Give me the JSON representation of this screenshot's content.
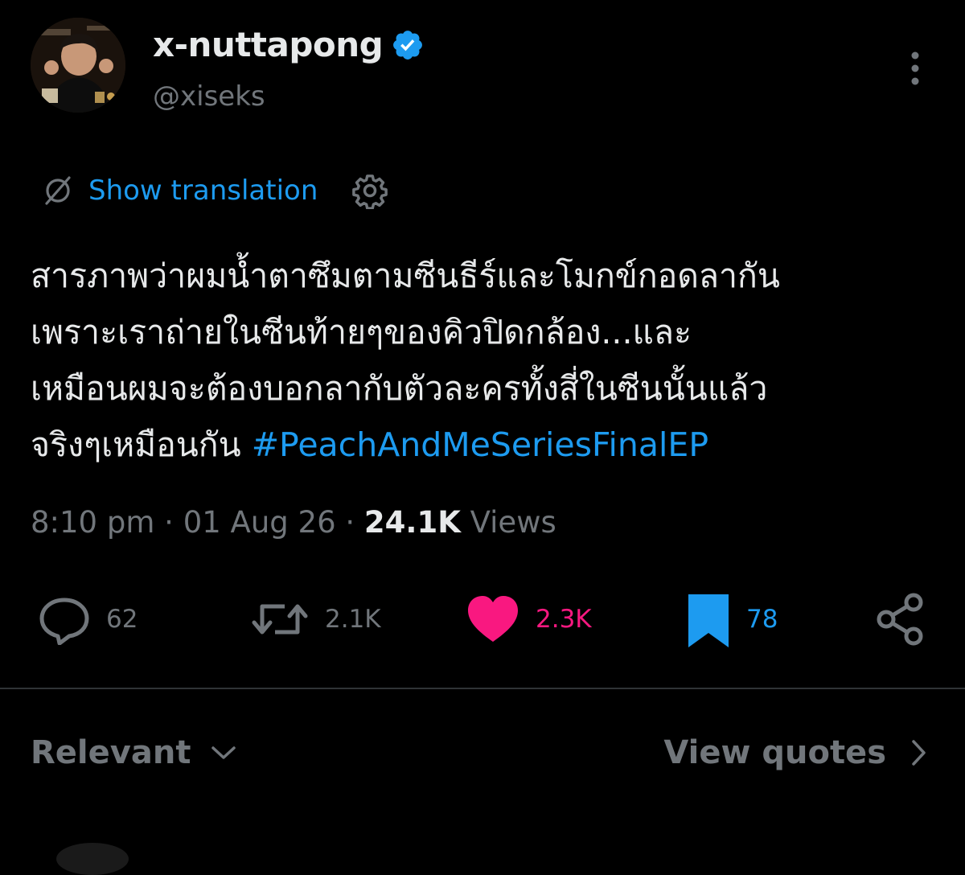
{
  "author": {
    "display_name": "x-nuttapong",
    "handle": "@xiseks",
    "verified_color": "#1d9bf0"
  },
  "translation": {
    "link_label": "Show translation",
    "icon": "translate-icon",
    "settings_icon": "gear-icon"
  },
  "tweet": {
    "lines": [
      "สารภาพว่าผมน้ำตาซึมตามซีนธีร์และโมกข์กอดลากัน",
      "เพราะเราถ่ายในซีนท้ายๆของคิวปิดกล้อง...และ",
      "เหมือนผมจะต้องบอกลากับตัวละครทั้งสี่ในซีนนั้นแล้ว",
      "จริงๆเหมือนกัน "
    ],
    "hashtag": "#PeachAndMeSeriesFinalEP"
  },
  "meta": {
    "time": "8:10 pm",
    "separator": " · ",
    "date": "01 Aug 26",
    "views_count": "24.1K",
    "views_label": " Views"
  },
  "actions": {
    "reply": {
      "icon": "reply-icon",
      "count": "62"
    },
    "repost": {
      "icon": "repost-icon",
      "count": "2.1K"
    },
    "like": {
      "icon": "heart-icon",
      "count": "2.3K",
      "color": "#f91880"
    },
    "bookmark": {
      "icon": "bookmark-icon",
      "count": "78",
      "color": "#1d9bf0"
    },
    "share": {
      "icon": "share-icon"
    }
  },
  "replies_bar": {
    "sort_label": "Relevant",
    "quotes_label": "View quotes"
  },
  "colors": {
    "background": "#000000",
    "text": "#e7e9ea",
    "muted": "#71767b",
    "accent": "#1d9bf0",
    "like": "#f91880",
    "divider": "#2f3336"
  }
}
